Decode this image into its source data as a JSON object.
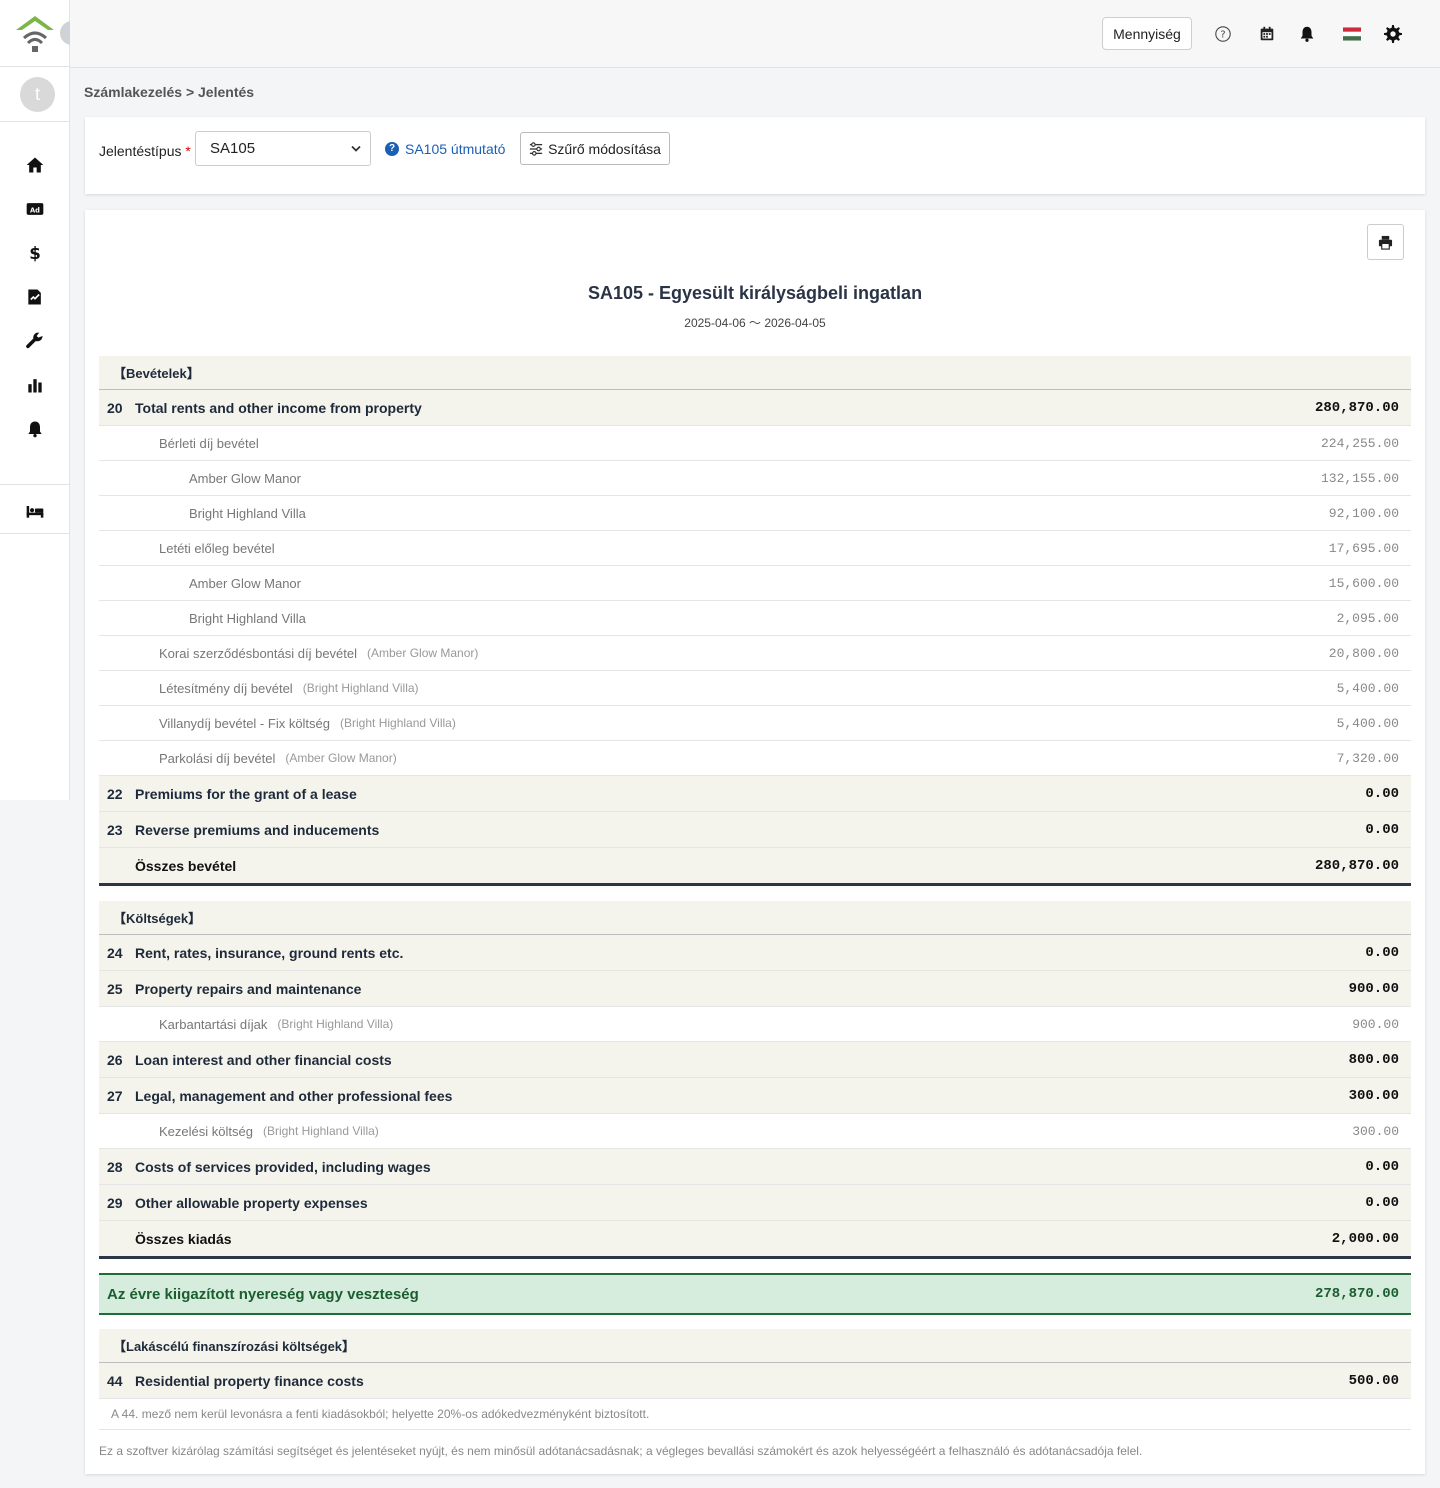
{
  "header": {
    "qty_label": "Mennyiség",
    "icons": [
      "help-icon",
      "calendar-icon",
      "bell-icon",
      "flag-icon",
      "gear-icon"
    ]
  },
  "sidebar": {
    "avatar_initial": "t",
    "logo_color": "#7ab648",
    "items": [
      "home-icon",
      "ad-icon",
      "dollar-icon",
      "invoice-icon",
      "wrench-icon",
      "chart-icon",
      "bell-icon",
      "bed-icon"
    ]
  },
  "breadcrumb": "Számlakezelés > Jelentés",
  "filter": {
    "label": "Jelentéstípus",
    "required_mark": "*",
    "selected": "SA105",
    "guide_link": "SA105 útmutató",
    "filter_button": "Szűrő módosítása"
  },
  "report": {
    "title": "SA105 - Egyesült királyságbeli ingatlan",
    "period": "2025-04-06 〜 2026-04-05",
    "income_section": "【Bevételek】",
    "income_rows": [
      {
        "type": "main",
        "num": "20",
        "label": "Total rents and other income from property",
        "amount": "280,870.00"
      },
      {
        "type": "sub",
        "indent": 1,
        "label": "Bérleti díj bevétel",
        "prop": "",
        "amount": "224,255.00"
      },
      {
        "type": "sub",
        "indent": 2,
        "label": "Amber Glow Manor",
        "prop": "",
        "amount": "132,155.00"
      },
      {
        "type": "sub",
        "indent": 2,
        "label": "Bright Highland Villa",
        "prop": "",
        "amount": "92,100.00"
      },
      {
        "type": "sub",
        "indent": 1,
        "label": "Letéti előleg bevétel",
        "prop": "",
        "amount": "17,695.00"
      },
      {
        "type": "sub",
        "indent": 2,
        "label": "Amber Glow Manor",
        "prop": "",
        "amount": "15,600.00"
      },
      {
        "type": "sub",
        "indent": 2,
        "label": "Bright Highland Villa",
        "prop": "",
        "amount": "2,095.00"
      },
      {
        "type": "sub",
        "indent": 1,
        "label": "Korai szerződésbontási díj bevétel",
        "prop": "(Amber Glow Manor)",
        "amount": "20,800.00"
      },
      {
        "type": "sub",
        "indent": 1,
        "label": "Létesítmény díj bevétel",
        "prop": "(Bright Highland Villa)",
        "amount": "5,400.00"
      },
      {
        "type": "sub",
        "indent": 1,
        "label": "Villanydíj bevétel - Fix költség",
        "prop": "(Bright Highland Villa)",
        "amount": "5,400.00"
      },
      {
        "type": "sub",
        "indent": 1,
        "label": "Parkolási díj bevétel",
        "prop": "(Amber Glow Manor)",
        "amount": "7,320.00"
      },
      {
        "type": "main",
        "num": "22",
        "label": "Premiums for the grant of a lease",
        "amount": "0.00"
      },
      {
        "type": "main",
        "num": "23",
        "label": "Reverse premiums and inducements",
        "amount": "0.00"
      }
    ],
    "income_total_label": "Összes bevétel",
    "income_total": "280,870.00",
    "expense_section": "【Költségek】",
    "expense_rows": [
      {
        "type": "main",
        "num": "24",
        "label": "Rent, rates, insurance, ground rents etc.",
        "amount": "0.00"
      },
      {
        "type": "main",
        "num": "25",
        "label": "Property repairs and maintenance",
        "amount": "900.00"
      },
      {
        "type": "sub",
        "indent": 1,
        "label": "Karbantartási díjak",
        "prop": "(Bright Highland Villa)",
        "amount": "900.00"
      },
      {
        "type": "main",
        "num": "26",
        "label": "Loan interest and other financial costs",
        "amount": "800.00"
      },
      {
        "type": "main",
        "num": "27",
        "label": "Legal, management and other professional fees",
        "amount": "300.00"
      },
      {
        "type": "sub",
        "indent": 1,
        "label": "Kezelési költség",
        "prop": "(Bright Highland Villa)",
        "amount": "300.00"
      },
      {
        "type": "main",
        "num": "28",
        "label": "Costs of services provided, including wages",
        "amount": "0.00"
      },
      {
        "type": "main",
        "num": "29",
        "label": "Other allowable property expenses",
        "amount": "0.00"
      }
    ],
    "expense_total_label": "Összes kiadás",
    "expense_total": "2,000.00",
    "profit_label": "Az évre kiigazított nyereség vagy veszteség",
    "profit_amount": "278,870.00",
    "finance_section": "【Lakáscélú finanszírozási költségek】",
    "finance_row": {
      "num": "44",
      "label": "Residential property finance costs",
      "amount": "500.00"
    },
    "finance_note": "A 44. mező nem kerül levonásra a fenti kiadásokból; helyette 20%-os adókedvezményként biztosított.",
    "disclaimer": "Ez a szoftver kizárólag számítási segítséget és jelentéseket nyújt, és nem minősül adótanácsadásnak; a végleges bevallási számokért és azok helyességéért a felhasználó és adótanácsadója felel."
  }
}
